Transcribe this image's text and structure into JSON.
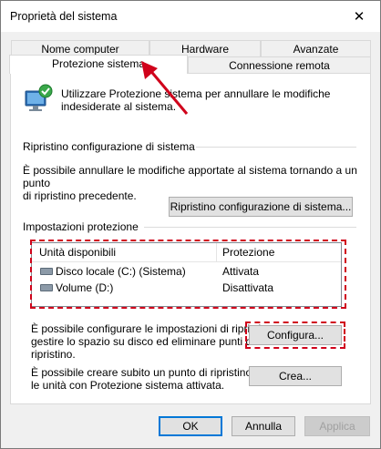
{
  "window": {
    "title": "Proprietà del sistema",
    "close_symbol": "✕"
  },
  "tabs": {
    "row1": [
      "Nome computer",
      "Hardware",
      "Avanzate"
    ],
    "row2": [
      "Protezione sistema",
      "Connessione remota"
    ],
    "active": "Protezione sistema"
  },
  "intro": {
    "text_line1": "Utilizzare Protezione sistema per annullare le modifiche",
    "text_line2": "indesiderate al sistema."
  },
  "restore": {
    "heading": "Ripristino configurazione di sistema",
    "text_line1": "È possibile annullare le modifiche apportate al sistema tornando a un punto",
    "text_line2": "di ripristino precedente.",
    "button": "Ripristino configurazione di sistema..."
  },
  "protection": {
    "heading": "Impostazioni protezione",
    "columns": [
      "Unità disponibili",
      "Protezione"
    ],
    "rows": [
      {
        "drive": "Disco locale (C:) (Sistema)",
        "status": "Attivata"
      },
      {
        "drive": "Volume (D:)",
        "status": "Disattivata"
      }
    ]
  },
  "configure": {
    "text_line1": "È possibile configurare le impostazioni di ripristino,",
    "text_line2": "gestire lo spazio su disco ed eliminare punti di",
    "text_line3": "ripristino.",
    "button": "Configura..."
  },
  "create": {
    "text_line1": "È possibile creare subito un punto di ripristino per",
    "text_line2": "le unità con Protezione sistema attivata.",
    "button": "Crea..."
  },
  "footer": {
    "ok": "OK",
    "cancel": "Annulla",
    "apply": "Applica"
  },
  "colors": {
    "annotation": "#d0021b",
    "focus_border": "#0078d7"
  },
  "icons": {
    "dialog_icon": "system-protection-icon",
    "drive_icon": "drive-icon"
  }
}
